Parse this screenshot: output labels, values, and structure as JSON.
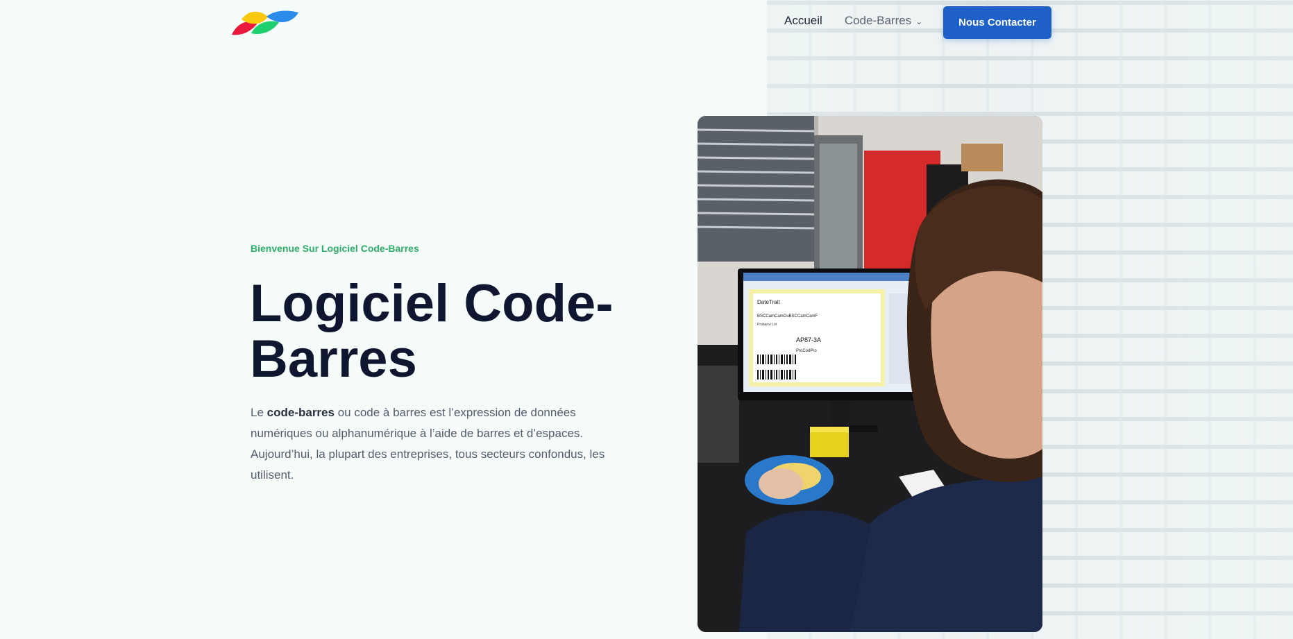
{
  "header": {
    "logo_icon": "brand-leaf-logo",
    "nav": [
      {
        "label": "Accueil"
      },
      {
        "label": "Code-Barres",
        "has_dropdown": true
      }
    ],
    "cta_label": "Nous Contacter"
  },
  "hero": {
    "eyebrow": "Bienvenue Sur Logiciel Code-Barres",
    "title": "Logiciel Code-Barres",
    "desc_prefix": "Le ",
    "desc_bold": "code-barres",
    "desc_rest": " ou code à barres est l’expression de données numériques ou alphanumérique à l’aide de  barres et d’espaces. Aujourd’hui, la plupart des entreprises, tous secteurs confondus, les utilisent.",
    "image_icon": "office-barcode-software-photo"
  },
  "screen": {
    "doc_title": "DateTrait",
    "line1": "BSCCamCamOuBSCCamCamF",
    "line2": "Probanvi Lot",
    "code": "AP87-3A",
    "line3": "ProCodPro"
  },
  "colors": {
    "accent": "#1f5fc8",
    "eyebrow": "#2fae6a",
    "title": "#0f1730",
    "logo_red": "#e8193c",
    "logo_yellow": "#f8c90d",
    "logo_green": "#1fcf6e",
    "logo_blue": "#2a8be8"
  }
}
